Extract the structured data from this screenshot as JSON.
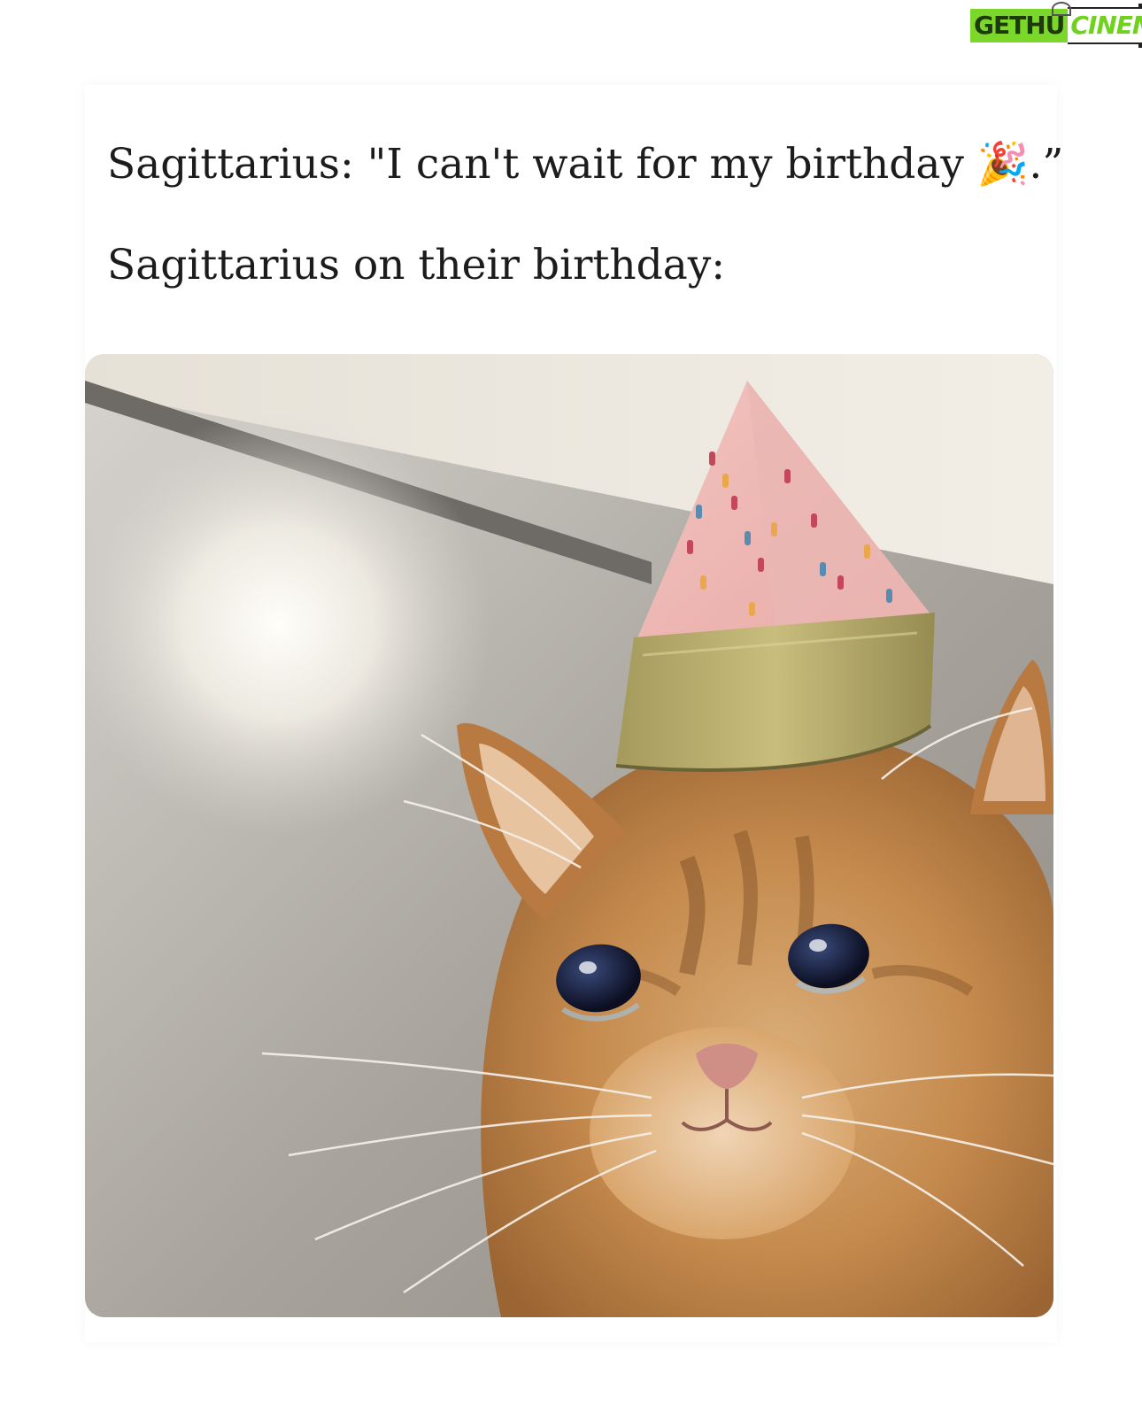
{
  "watermark": {
    "left": "GETHU",
    "right": "CINEMA"
  },
  "post": {
    "line1": "Sagittarius: \"I can't wait for my birthday 🎉.”",
    "line2": "Sagittarius on their birthday:"
  },
  "photo": {
    "icon": "crying-cat-party-hat-image"
  }
}
